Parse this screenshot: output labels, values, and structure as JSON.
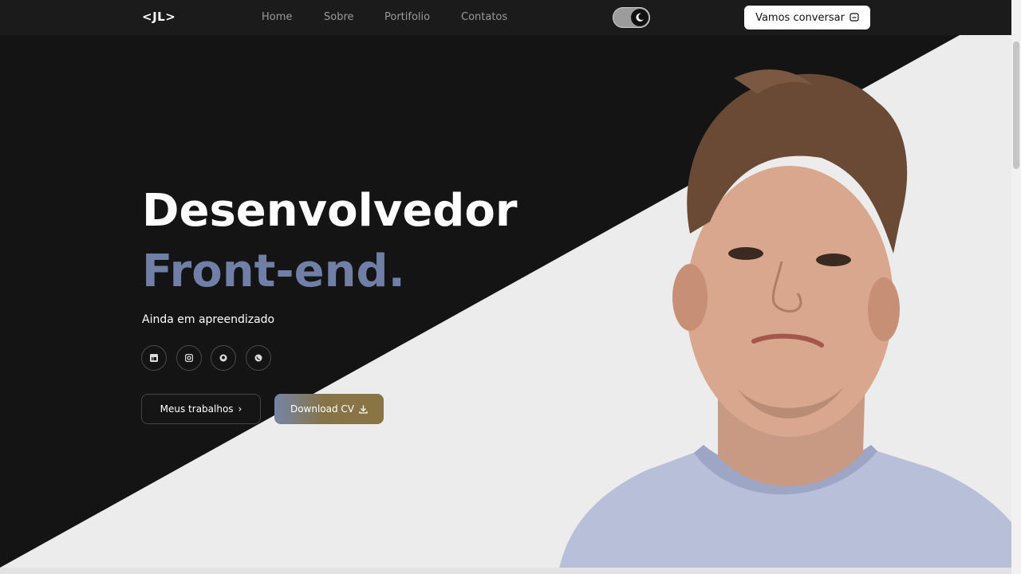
{
  "nav": {
    "logo": "<JL>",
    "items": [
      "Home",
      "Sobre",
      "Portifolio",
      "Contatos"
    ],
    "cta_label": "Vamos conversar"
  },
  "hero": {
    "title_line1": "Desenvolvedor",
    "title_line2": "Front-end.",
    "subtitle": "Ainda em apreendizado",
    "social_icons": [
      "linkedin-icon",
      "instagram-icon",
      "github-icon",
      "whatsapp-icon"
    ],
    "btn_primary": "Meus trabalhos",
    "btn_secondary": "Download CV"
  },
  "colors": {
    "dark_bg": "#141414",
    "light_bg": "#ececec",
    "accent_blue": "#6f7fa6",
    "accent_gold": "#8a7443"
  }
}
